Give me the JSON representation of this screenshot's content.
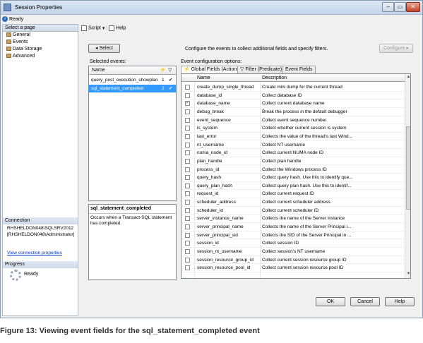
{
  "window": {
    "title": "Session Properties",
    "status": "Ready"
  },
  "left": {
    "select_page_header": "Select a page",
    "pages": [
      "General",
      "Events",
      "Data Storage",
      "Advanced"
    ],
    "connection_header": "Connection",
    "connection_lines": [
      "RHSHELDON048\\SQLSRV2012",
      "[RHSHELDON048\\Administrator]"
    ],
    "view_connection_link": "View connection properties",
    "progress_header": "Progress",
    "progress_status": "Ready"
  },
  "toolbar": {
    "script_label": "Script",
    "help_label": "Help"
  },
  "main": {
    "select_button": "Select",
    "configure_text": "Configure the events to collect additional fields and specify filters.",
    "configure_button": "Configure",
    "selected_events_label": "Selected events:",
    "selected_events_header": "Name",
    "selected_events": [
      {
        "name": "query_post_execution_showplan",
        "count": "1",
        "mark": "✔"
      },
      {
        "name": "sql_statement_completed",
        "count": "2",
        "mark": "✔"
      }
    ],
    "description_title": "sql_statement_completed",
    "description_text": "Occurs when a Transact-SQL statement has completed.",
    "config_options_label": "Event configuration options:",
    "tabs": [
      "Global Fields (Actions)",
      "Filter (Predicate)",
      "Event Fields"
    ],
    "fields_header": {
      "name": "Name",
      "description": "Description"
    },
    "fields": [
      {
        "name": "create_dump_single_thread",
        "description": "Create mini dump for the current thread",
        "checked": false
      },
      {
        "name": "database_id",
        "description": "Collect database ID",
        "checked": false
      },
      {
        "name": "database_name",
        "description": "Collect current database name",
        "checked": true
      },
      {
        "name": "debug_break",
        "description": "Break the process in the default debugger",
        "checked": false
      },
      {
        "name": "event_sequence",
        "description": "Collect event sequence number",
        "checked": false
      },
      {
        "name": "is_system",
        "description": "Collect whether current session is system",
        "checked": false
      },
      {
        "name": "last_error",
        "description": "Collects the value of the thread's last Wind...",
        "checked": false
      },
      {
        "name": "nt_username",
        "description": "Collect NT username",
        "checked": false
      },
      {
        "name": "numa_node_id",
        "description": "Collect current NUMA node ID",
        "checked": false
      },
      {
        "name": "plan_handle",
        "description": "Collect plan handle",
        "checked": false
      },
      {
        "name": "process_id",
        "description": "Collect the Windows process ID",
        "checked": false
      },
      {
        "name": "query_hash",
        "description": "Collect query hash. Use this to identify que...",
        "checked": false
      },
      {
        "name": "query_plan_hash",
        "description": "Collect query plan hash. Use this to identif...",
        "checked": false
      },
      {
        "name": "request_id",
        "description": "Collect current request ID",
        "checked": false
      },
      {
        "name": "scheduler_address",
        "description": "Collect current scheduler address",
        "checked": false
      },
      {
        "name": "scheduler_id",
        "description": "Collect current scheduler ID",
        "checked": false
      },
      {
        "name": "server_instance_name",
        "description": "Collects the name of the Server instance",
        "checked": false
      },
      {
        "name": "server_principal_name",
        "description": "Collects the name of the Server Principal i...",
        "checked": false
      },
      {
        "name": "server_principal_sid",
        "description": "Collects the SID of the Server Principal in ...",
        "checked": false
      },
      {
        "name": "session_id",
        "description": "Collect session ID",
        "checked": false
      },
      {
        "name": "session_nt_username",
        "description": "Collect session's NT username",
        "checked": false
      },
      {
        "name": "session_resource_group_id",
        "description": "Collect current session resource group ID",
        "checked": false
      },
      {
        "name": "session_resource_pool_id",
        "description": "Collect current session resource pool ID",
        "checked": false
      }
    ]
  },
  "buttons": {
    "ok": "OK",
    "cancel": "Cancel",
    "help": "Help"
  },
  "caption": "Figure 13: Viewing event fields for the sql_statement_completed event"
}
